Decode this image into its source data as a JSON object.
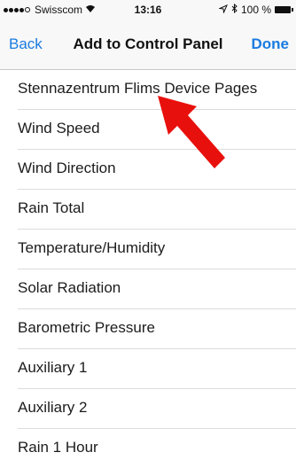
{
  "status_bar": {
    "carrier": "Swisscom",
    "time": "13:16",
    "battery_percent": "100 %",
    "signal_bars": 4,
    "signal_total": 5
  },
  "nav": {
    "back_label": "Back",
    "title": "Add to Control Panel",
    "done_label": "Done"
  },
  "list": {
    "items": [
      "Stennazentrum Flims Device Pages",
      "Wind Speed",
      "Wind Direction",
      "Rain Total",
      "Temperature/Humidity",
      "Solar Radiation",
      "Barometric Pressure",
      "Auxiliary 1",
      "Auxiliary 2",
      "Rain 1 Hour"
    ]
  },
  "colors": {
    "accent": "#1a7be0",
    "annotation_arrow": "#e8100c"
  },
  "icons": {
    "wifi": "wifi-icon",
    "location": "location-arrow-icon",
    "bluetooth": "bluetooth-icon",
    "battery": "battery-icon"
  }
}
